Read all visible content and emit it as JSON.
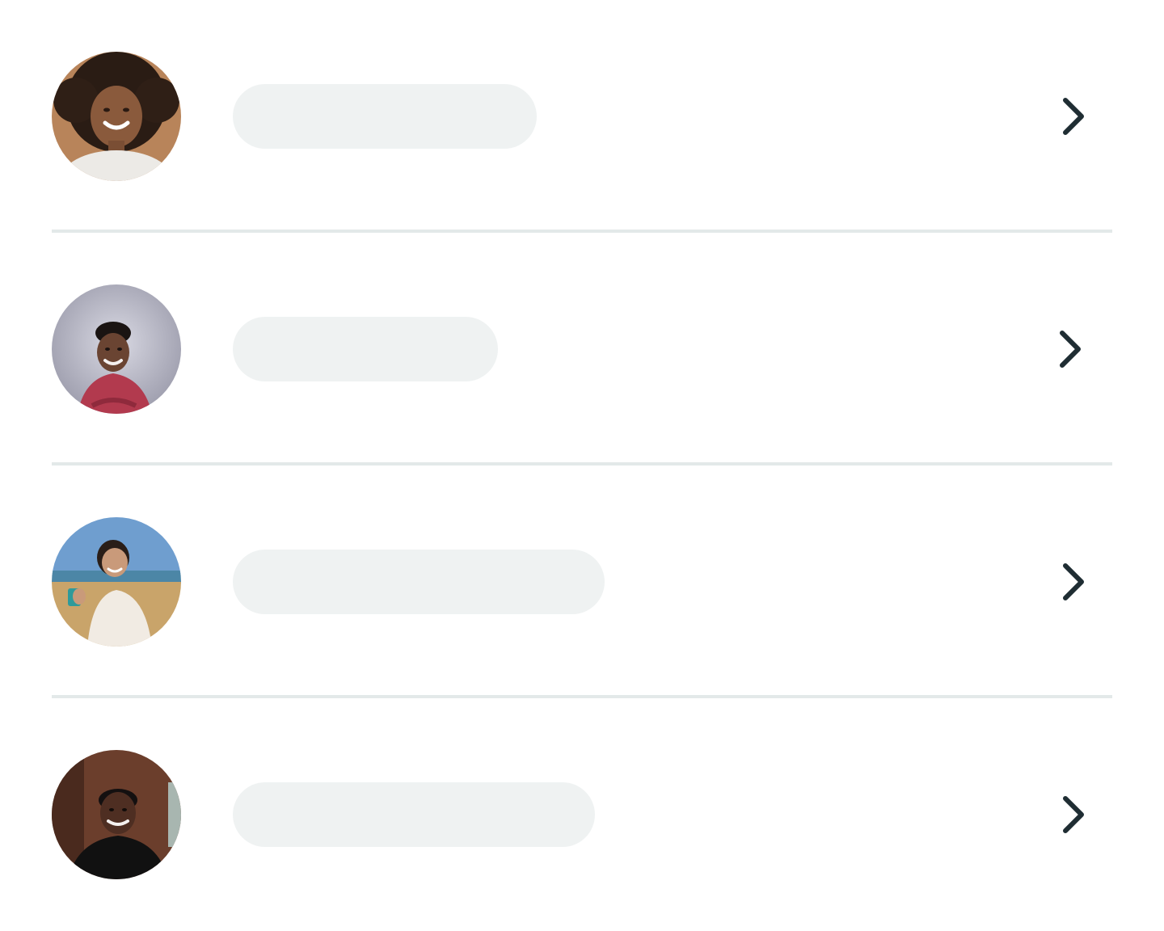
{
  "list": {
    "items": [
      {
        "avatar": "avatar-woman-curly-hair",
        "loading": true,
        "chevron_icon": "chevron-right-icon"
      },
      {
        "avatar": "avatar-man-red-shirt",
        "loading": true,
        "chevron_icon": "chevron-right-icon"
      },
      {
        "avatar": "avatar-woman-beach",
        "loading": true,
        "chevron_icon": "chevron-right-icon"
      },
      {
        "avatar": "avatar-man-dark-shirt",
        "loading": true,
        "chevron_icon": "chevron-right-icon"
      }
    ]
  },
  "colors": {
    "skeleton": "#eff2f2",
    "divider": "#e3e9e9",
    "chevron": "#1f2d33",
    "background": "#ffffff"
  }
}
